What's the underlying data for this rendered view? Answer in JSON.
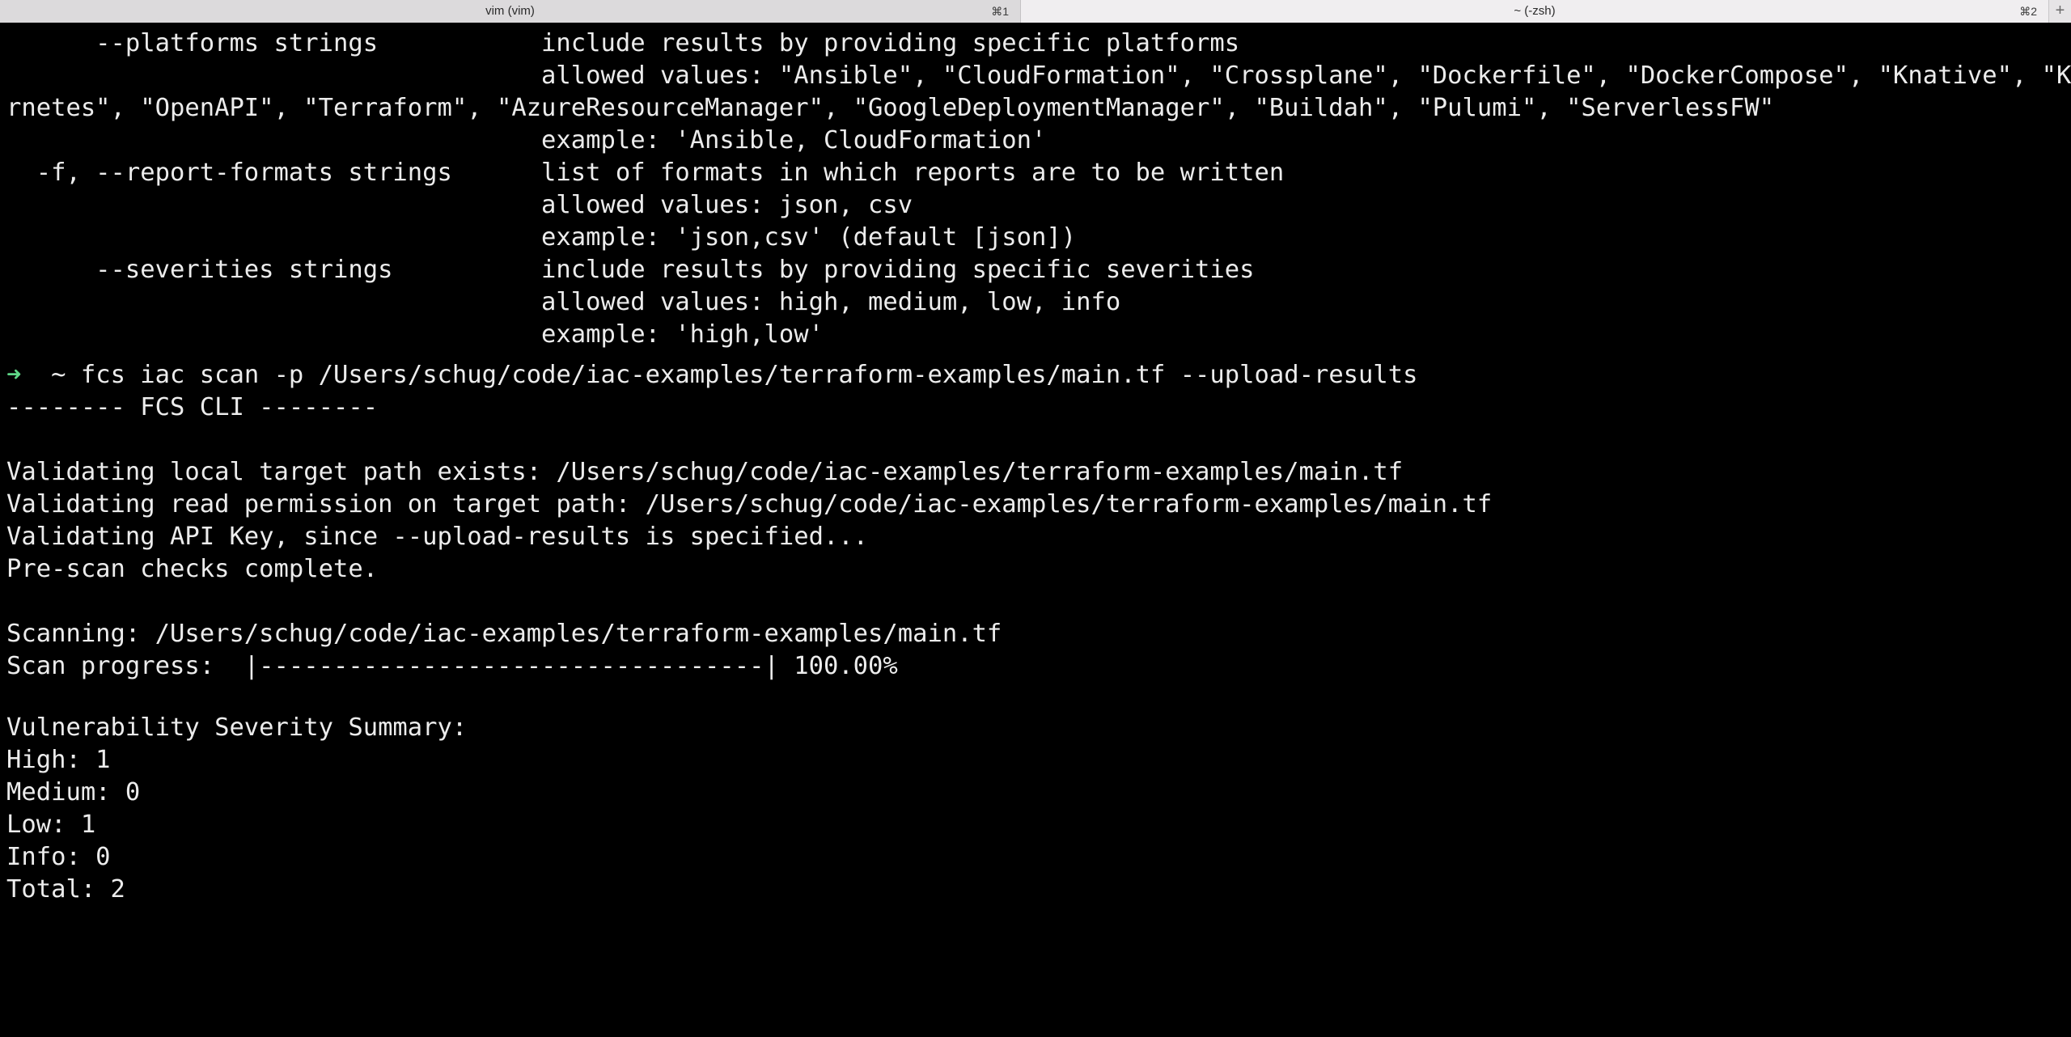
{
  "tabs": [
    {
      "title": "vim (vim)",
      "shortcut": "⌘1"
    },
    {
      "title": "~ (-zsh)",
      "shortcut": "⌘2"
    }
  ],
  "new_tab_label": "+",
  "terminal": {
    "help_lines": [
      "      --platforms strings           include results by providing specific platforms",
      "                                    allowed values: \"Ansible\", \"CloudFormation\", \"Crossplane\", \"Dockerfile\", \"DockerCompose\", \"Knative\", \"Kube",
      "rnetes\", \"OpenAPI\", \"Terraform\", \"AzureResourceManager\", \"GoogleDeploymentManager\", \"Buildah\", \"Pulumi\", \"ServerlessFW\"",
      "                                    example: 'Ansible, CloudFormation'",
      "  -f, --report-formats strings      list of formats in which reports are to be written",
      "                                    allowed values: json, csv",
      "                                    example: 'json,csv' (default [json])",
      "      --severities strings          include results by providing specific severities",
      "                                    allowed values: high, medium, low, info",
      "                                    example: 'high,low'"
    ],
    "prompt_symbol": "➜",
    "prompt_cwd": "~",
    "command": "fcs iac scan -p /Users/schug/code/iac-examples/terraform-examples/main.tf --upload-results",
    "output_lines": [
      "-------- FCS CLI --------",
      "",
      "Validating local target path exists: /Users/schug/code/iac-examples/terraform-examples/main.tf",
      "Validating read permission on target path: /Users/schug/code/iac-examples/terraform-examples/main.tf",
      "Validating API Key, since --upload-results is specified...",
      "Pre-scan checks complete.",
      "",
      "Scanning: /Users/schug/code/iac-examples/terraform-examples/main.tf",
      "Scan progress:  |----------------------------------| 100.00%",
      "",
      "Vulnerability Severity Summary:",
      "High: 1",
      "Medium: 0",
      "Low: 1",
      "Info: 0",
      "Total: 2"
    ]
  },
  "colors": {
    "background": "#000000",
    "foreground": "#ececec",
    "prompt_arrow": "#5fd787"
  }
}
